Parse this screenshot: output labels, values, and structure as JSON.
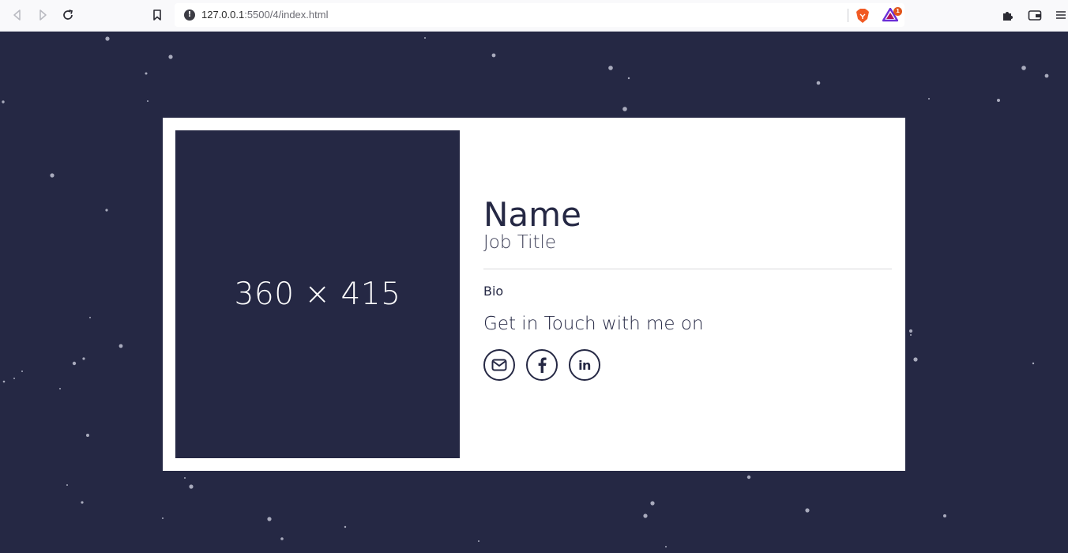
{
  "browser": {
    "url_host": "127.0.0.1",
    "url_path": ":5500/4/index.html",
    "rewards_badge": "1",
    "icons": [
      "back-icon",
      "forward-icon",
      "reload-icon",
      "bookmark-icon",
      "site-info-icon",
      "brave-shields-icon",
      "brave-rewards-icon",
      "extensions-icon",
      "wallet-icon",
      "menu-icon"
    ]
  },
  "page": {
    "background_color": "#252844",
    "card_color": "#ffffff"
  },
  "profile": {
    "photo_placeholder": "360 × 415",
    "name": "Name",
    "job_title": "Job Title",
    "bio": "Bio",
    "contact_heading": "Get in Touch with me on",
    "socials": [
      {
        "icon": "email-icon"
      },
      {
        "icon": "facebook-icon"
      },
      {
        "icon": "linkedin-icon",
        "glyph": "in"
      }
    ]
  }
}
